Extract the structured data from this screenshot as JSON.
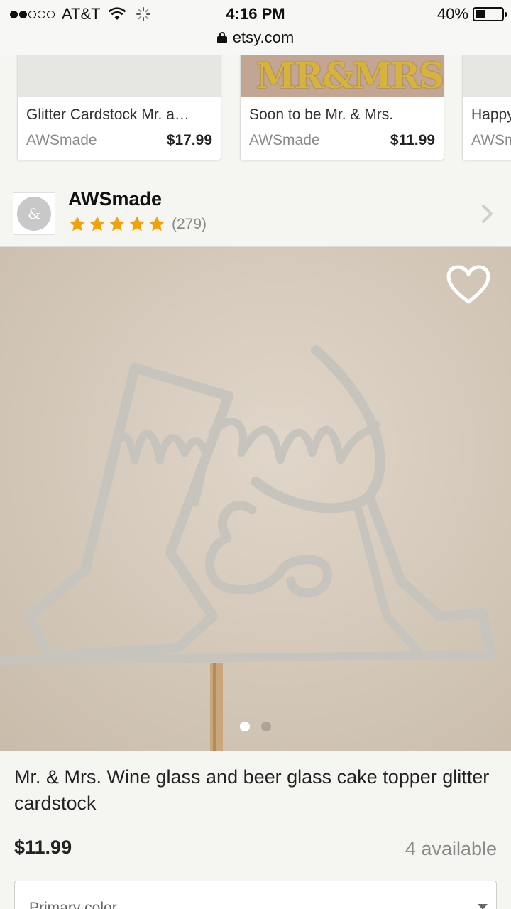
{
  "status_bar": {
    "carrier": "AT&T",
    "time": "4:16 PM",
    "battery": "40%",
    "battery_level": 0.4,
    "url": "etsy.com"
  },
  "related_items": [
    {
      "title": "Glitter Cardstock Mr. a…",
      "shop": "AWSmade",
      "price": "$17.99"
    },
    {
      "title": "Soon to be Mr. & Mrs.",
      "shop": "AWSmade",
      "price": "$11.99",
      "thumb_text": "MR&MRS"
    },
    {
      "title": "Happy",
      "shop": "AWSmade",
      "price": ""
    }
  ],
  "shop": {
    "name": "AWSmade",
    "rating": 5,
    "reviews": "(279)",
    "star_color": "#f1a208"
  },
  "listing": {
    "title": "Mr. & Mrs. Wine glass and beer glass cake topper glitter cardstock",
    "price": "$11.99",
    "availability": "4 available",
    "image_count": 2,
    "active_image": 1,
    "option_label": "Primary color"
  }
}
